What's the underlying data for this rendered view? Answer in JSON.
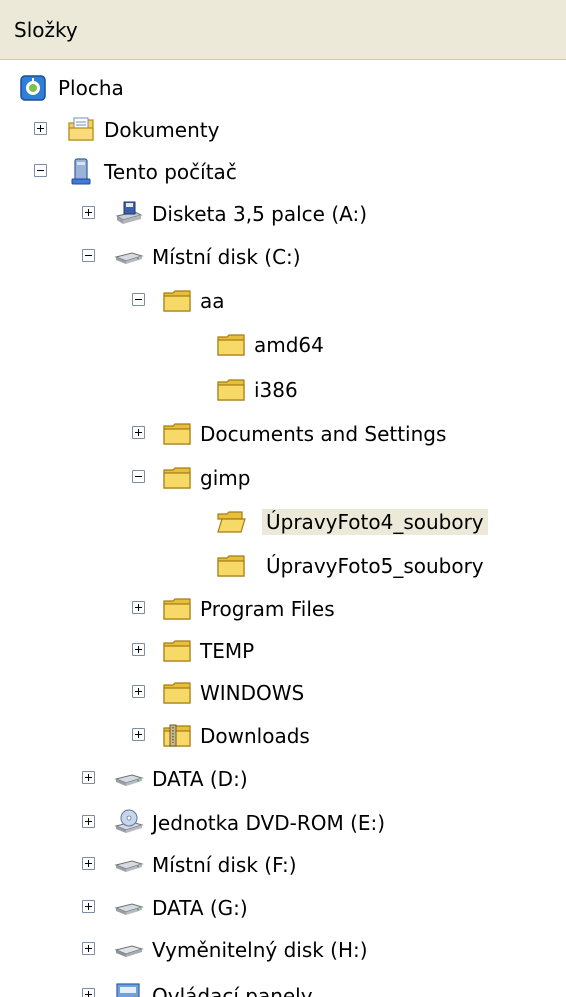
{
  "panel": {
    "title": "Složky"
  },
  "tree": {
    "plocha": "Plocha",
    "dokumenty": "Dokumenty",
    "tento_pocitac": "Tento počítač",
    "disketa": "Disketa 3,5 palce (A:)",
    "disk_c": "Místní disk (C:)",
    "aa": "aa",
    "amd64": "amd64",
    "i386": "i386",
    "documents_and_settings": "Documents and Settings",
    "gimp": "gimp",
    "upravy4": "ÚpravyFoto4_soubory",
    "upravy5": "ÚpravyFoto5_soubory",
    "program_files": "Program Files",
    "temp": "TEMP",
    "windows": "WINDOWS",
    "downloads": "Downloads",
    "data_d": "DATA (D:)",
    "dvd_e": "Jednotka DVD-ROM (E:)",
    "disk_f": "Místní disk (F:)",
    "data_g": "DATA (G:)",
    "removable_h": "Vyměnitelný disk (H:)",
    "ovladaci_panely": "Ovládací panely"
  },
  "state": {
    "selected_item": "ÚpravyFoto4_soubory",
    "expanded": [
      "Tento počítač",
      "Místní disk (C:)",
      "aa",
      "gimp"
    ]
  },
  "colors": {
    "header_bg": "#ece9d8",
    "selection_bg": "#ece9d8",
    "folder_yellow": "#f4d25f",
    "toggle_border": "#7b8ea6"
  }
}
